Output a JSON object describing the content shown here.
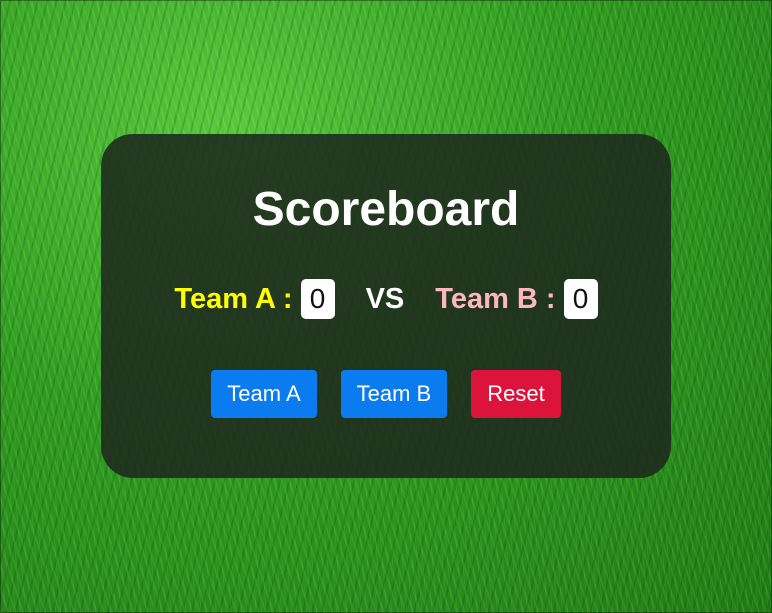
{
  "title": "Scoreboard",
  "team_a": {
    "label": "Team A :",
    "score": "0"
  },
  "vs": "VS",
  "team_b": {
    "label": "Team B :",
    "score": "0"
  },
  "buttons": {
    "team_a": "Team A",
    "team_b": "Team B",
    "reset": "Reset"
  },
  "colors": {
    "team_a": "#ffff00",
    "team_b": "#ffb6c1",
    "button_blue": "#0a7cf0",
    "button_reset": "#dc143c",
    "background": "#2f9b1e"
  }
}
